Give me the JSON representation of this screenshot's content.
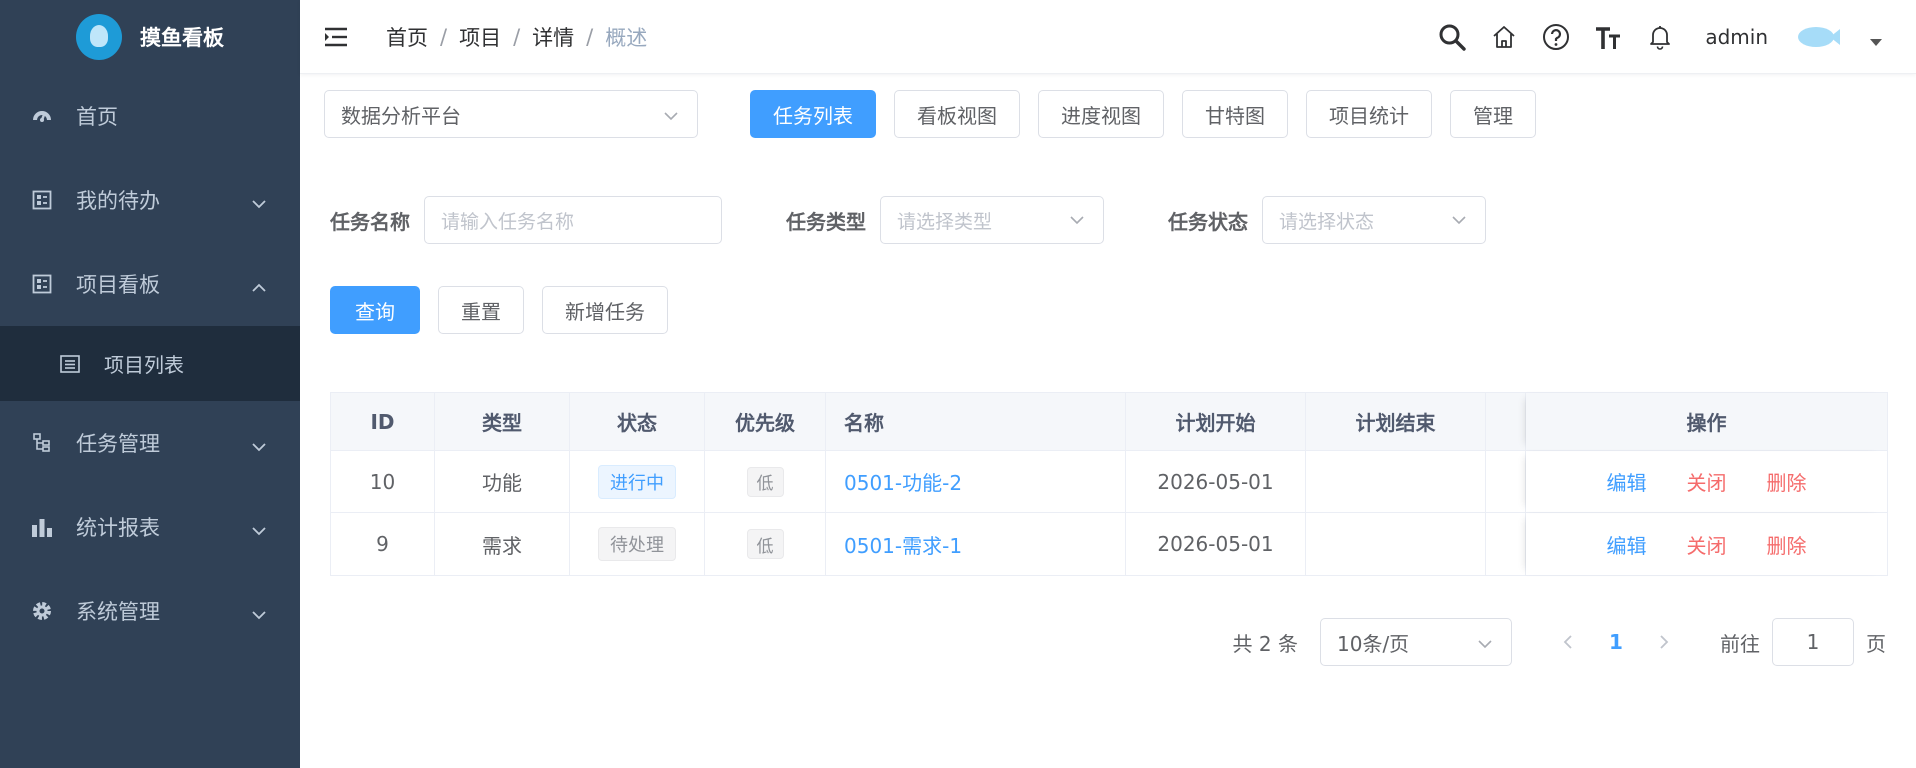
{
  "app": {
    "title": "摸鱼看板"
  },
  "sidebar": {
    "items": [
      {
        "label": "首页",
        "icon": "dashboard-icon"
      },
      {
        "label": "我的待办",
        "icon": "todo-icon"
      },
      {
        "label": "项目看板",
        "icon": "board-icon"
      },
      {
        "label": "项目列表",
        "icon": "list-icon"
      },
      {
        "label": "任务管理",
        "icon": "tree-icon"
      },
      {
        "label": "统计报表",
        "icon": "bar-chart-icon"
      },
      {
        "label": "系统管理",
        "icon": "gear-icon"
      }
    ]
  },
  "breadcrumb": {
    "items": [
      "首页",
      "项目",
      "详情"
    ],
    "current": "概述",
    "separator": "/"
  },
  "navbar": {
    "username": "admin"
  },
  "project": {
    "selected": "数据分析平台"
  },
  "view_tabs": [
    "任务列表",
    "看板视图",
    "进度视图",
    "甘特图",
    "项目统计",
    "管理"
  ],
  "filters": {
    "name_label": "任务名称",
    "name_placeholder": "请输入任务名称",
    "type_label": "任务类型",
    "type_placeholder": "请选择类型",
    "status_label": "任务状态",
    "status_placeholder": "请选择状态"
  },
  "actions": {
    "query": "查询",
    "reset": "重置",
    "add": "新增任务"
  },
  "table": {
    "headers": [
      "ID",
      "类型",
      "状态",
      "优先级",
      "名称",
      "计划开始",
      "计划结束",
      "操作"
    ],
    "rows": [
      {
        "id": "10",
        "type": "功能",
        "status": "进行中",
        "priority": "低",
        "name": "0501-功能-2",
        "start": "2026-05-01",
        "end": ""
      },
      {
        "id": "9",
        "type": "需求",
        "status": "待处理",
        "priority": "低",
        "name": "0501-需求-1",
        "start": "2026-05-01",
        "end": ""
      }
    ],
    "ops": {
      "edit": "编辑",
      "close": "关闭",
      "delete": "删除"
    }
  },
  "pagination": {
    "total": "共 2 条",
    "page_size": "10条/页",
    "current": "1",
    "goto_label": "前往",
    "goto_value": "1",
    "page_suffix": "页"
  },
  "colors": {
    "sidebar_bg": "#304156",
    "primary": "#409eff",
    "danger": "#f56c6c"
  }
}
